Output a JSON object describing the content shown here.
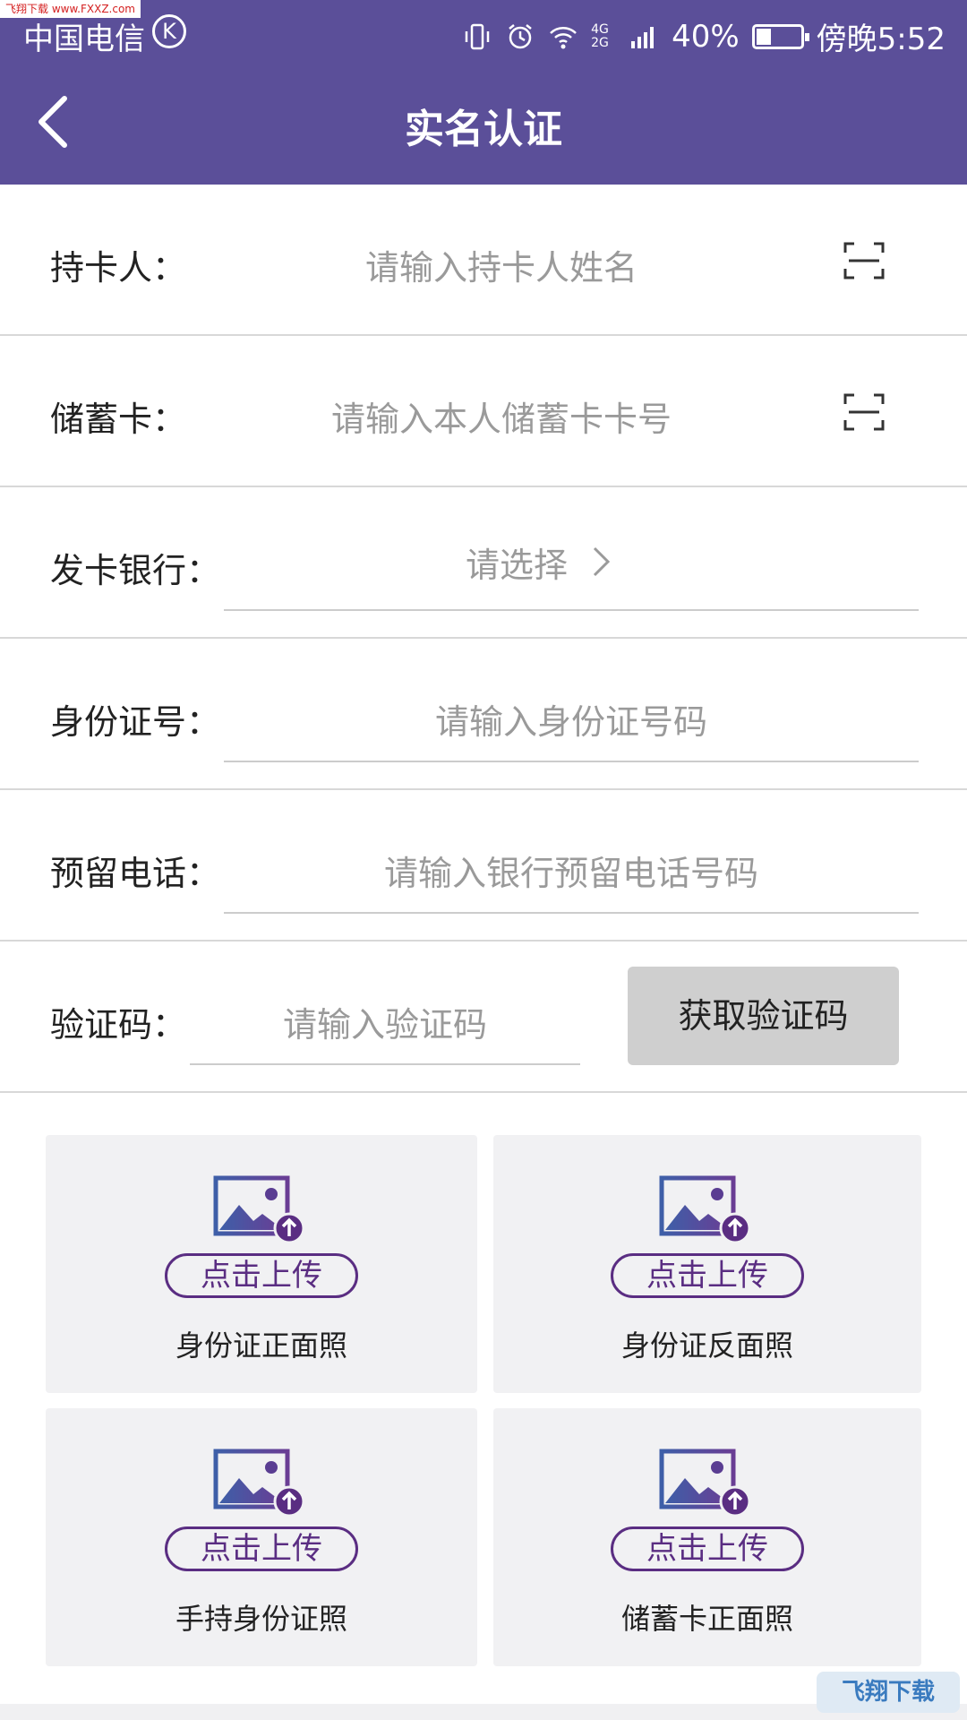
{
  "watermark_top": "飞翔下载 www.FXXZ.com",
  "status": {
    "carrier": "中国电信",
    "carrier_badge": "K",
    "network": "4G 2G",
    "battery_pct": "40%",
    "time": "傍晚5:52",
    "icons": [
      "vibrate-icon",
      "alarm-icon",
      "wifi-icon",
      "signal-icon",
      "battery-icon"
    ]
  },
  "header": {
    "title": "实名认证",
    "back_icon": "chevron-left-icon"
  },
  "form": {
    "cardholder": {
      "label": "持卡人：",
      "placeholder": "请输入持卡人姓名"
    },
    "debit_card": {
      "label": "储蓄卡：",
      "placeholder": "请输入本人储蓄卡卡号"
    },
    "bank": {
      "label": "发卡银行：",
      "placeholder": "请选择"
    },
    "id_number": {
      "label": "身份证号：",
      "placeholder": "请输入身份证号码"
    },
    "phone": {
      "label": "预留电话：",
      "placeholder": "请输入银行预留电话号码"
    },
    "code": {
      "label": "验证码：",
      "placeholder": "请输入验证码",
      "button": "获取验证码"
    }
  },
  "uploads": [
    {
      "button": "点击上传",
      "caption": "身份证正面照"
    },
    {
      "button": "点击上传",
      "caption": "身份证反面照"
    },
    {
      "button": "点击上传",
      "caption": "手持身份证照"
    },
    {
      "button": "点击上传",
      "caption": "储蓄卡正面照"
    }
  ],
  "watermark_bottom": "飞翔下载",
  "colors": {
    "header": "#5b4f99",
    "accent": "#5a2d82",
    "placeholder": "#9a9a9a",
    "code_button": "#cfcfcf",
    "card_bg": "#f1f1f3"
  }
}
